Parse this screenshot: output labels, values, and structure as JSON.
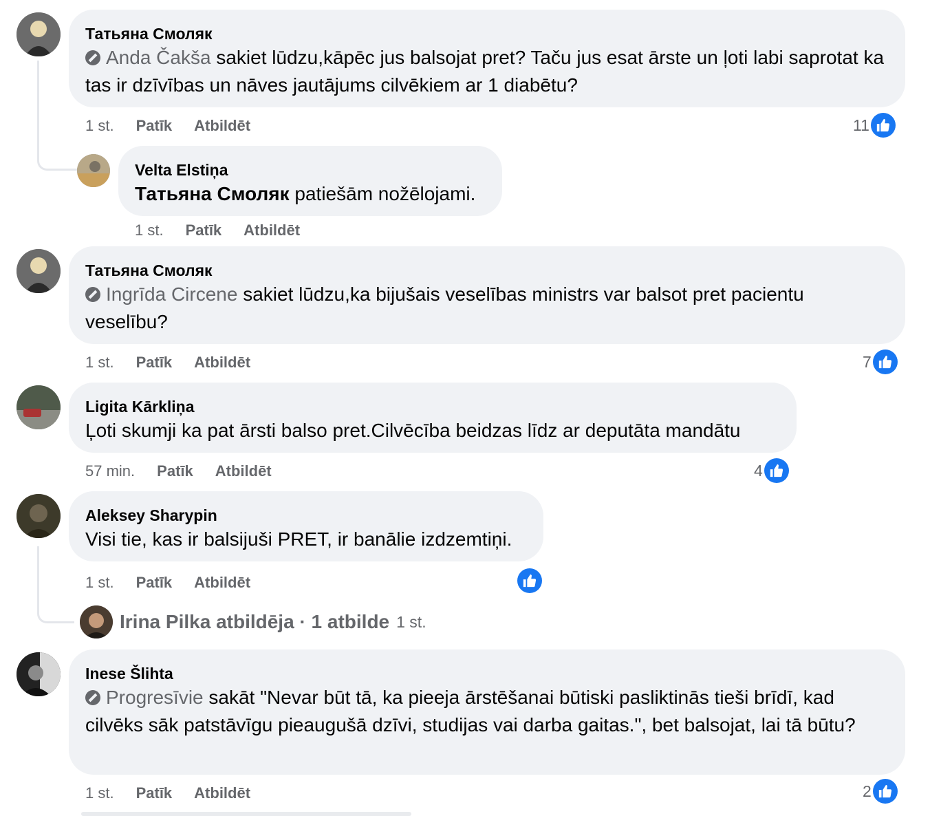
{
  "comments": [
    {
      "author": "Татьяна Смоляк",
      "mention": "Anda Čakša",
      "text": " sakiet lūdzu,kāpēc jus balsojat pret? Taču jus esat ārste un ļoti labi saprotat ka tas ir dzīvības un nāves jautājums cilvēkiem ar 1 diabētu?",
      "time": "1 st.",
      "like_label": "Patīk",
      "reply_label": "Atbildēt",
      "likes": "11"
    },
    {
      "author": "Velta Elstiņa",
      "mention": "Татьяна Смоляк",
      "text": " patiešām nožēlojami.",
      "time": "1 st.",
      "like_label": "Patīk",
      "reply_label": "Atbildēt"
    },
    {
      "author": "Татьяна Смоляк",
      "mention": "Ingrīda Circene",
      "text": " sakiet lūdzu,ka bijušais veselības ministrs var balsot pret pacientu veselību?",
      "time": "1 st.",
      "like_label": "Patīk",
      "reply_label": "Atbildēt",
      "likes": "7"
    },
    {
      "author": "Ligita Kārkliņa",
      "text": "Ļoti skumji ka pat ārsti balso pret.Cilvēcība beidzas līdz ar deputāta mandātu",
      "time": "57 min.",
      "like_label": "Patīk",
      "reply_label": "Atbildēt",
      "likes": "4"
    },
    {
      "author": "Aleksey Sharypin",
      "text": "Visi tie, kas ir balsijuši PRET, ir banālie izdzemtiņi.",
      "time": "1 st.",
      "like_label": "Patīk",
      "reply_label": "Atbildēt"
    },
    {
      "author": "Inese Šlihta",
      "mention": "Progresīvie",
      "text": " sakāt \"Nevar būt tā, ka pieeja ārstēšanai būtiski pasliktinās tieši brīdī, kad cilvēks sāk patstāvīgu pieaugušā dzīvi, studijas vai darba gaitas.\", bet balsojat, lai tā būtu?",
      "time": "1 st.",
      "like_label": "Patīk",
      "reply_label": "Atbildēt",
      "likes": "2"
    }
  ],
  "replies_summary": {
    "text": "Irina Pilka atbildēja · 1 atbilde",
    "time": "1 st."
  },
  "colors": {
    "bubble": "#f0f2f5",
    "secondary_text": "#65676b",
    "like_blue": "#1877f2"
  },
  "icons": [
    "like-icon",
    "tag-icon",
    "avatar"
  ]
}
